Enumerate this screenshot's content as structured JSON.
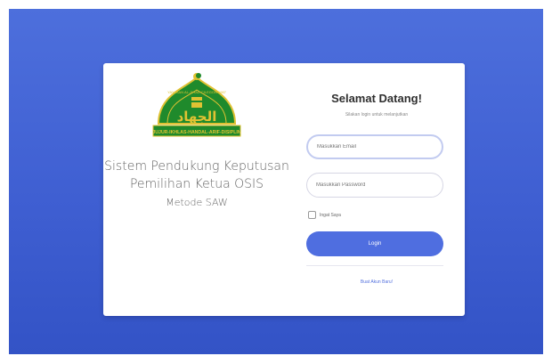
{
  "branding": {
    "logo_arabic": "الجهاد",
    "logo_arc_text": "YAYASAN AL-JIHAD CILEGON 1967",
    "logo_motto": "JUJUR-IKHLAS-HANDAL-ARIF-DISIPLIN",
    "app_line1": "Sistem Pendukung Keputusan",
    "app_line2": "Pemilihan Ketua OSIS",
    "app_line3": "Metode SAW"
  },
  "login": {
    "title": "Selamat Datang!",
    "subtitle": "Silakan login untuk melanjutkan",
    "email_placeholder": "Masukkan Email",
    "password_placeholder": "Masukkan Password",
    "remember_label": "Ingat Saya",
    "login_button": "Login",
    "register_link": "Buat Akun Baru!"
  },
  "colors": {
    "background_blue": "#4466d8",
    "button_blue": "#4f6ee0",
    "logo_green": "#1f8a2c",
    "logo_gold": "#e0c233"
  }
}
